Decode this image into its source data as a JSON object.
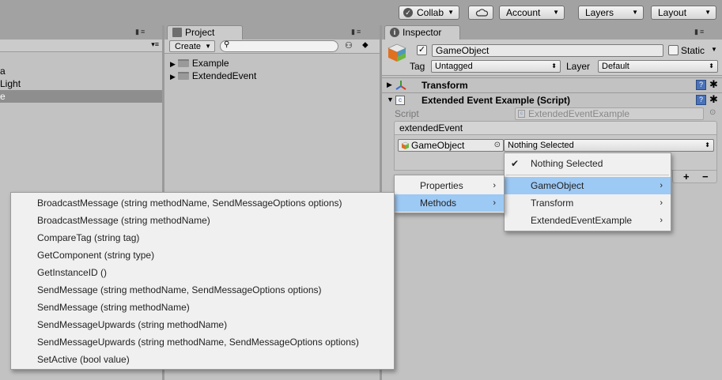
{
  "toolbar": {
    "collab_label": "Collab",
    "account_label": "Account",
    "layers_label": "Layers",
    "layout_label": "Layout"
  },
  "hierarchy": {
    "items": [
      "a",
      "Light",
      "e"
    ]
  },
  "project": {
    "tab_label": "Project",
    "create_label": "Create",
    "search_placeholder": "",
    "items": [
      "Example",
      "ExtendedEvent"
    ]
  },
  "inspector": {
    "tab_label": "Inspector",
    "object_name": "GameObject",
    "static_label": "Static",
    "tag_label": "Tag",
    "tag_value": "Untagged",
    "layer_label": "Layer",
    "layer_value": "Default",
    "transform_label": "Transform",
    "script_component_label": "Extended Event Example (Script)",
    "script_field_label": "Script",
    "script_field_value": "ExtendedEventExample",
    "event_header": "extendedEvent",
    "target_object": "GameObject",
    "function_dropdown": "Nothing Selected",
    "add_symbol": "+",
    "remove_symbol": "−"
  },
  "menus": {
    "function_menu": {
      "items": [
        {
          "label": "Nothing Selected",
          "checked": true,
          "submenu": false
        },
        {
          "label": "GameObject",
          "checked": false,
          "submenu": true,
          "highlight": true
        },
        {
          "label": "Transform",
          "checked": false,
          "submenu": true
        },
        {
          "label": "ExtendedEventExample",
          "checked": false,
          "submenu": true
        }
      ]
    },
    "category_menu": {
      "items": [
        {
          "label": "Properties",
          "highlight": false
        },
        {
          "label": "Methods",
          "highlight": true
        }
      ]
    },
    "methods_menu": {
      "items": [
        "BroadcastMessage (string methodName, SendMessageOptions options)",
        "BroadcastMessage (string methodName)",
        "CompareTag (string tag)",
        "GetComponent (string type)",
        "GetInstanceID ()",
        "SendMessage (string methodName, SendMessageOptions options)",
        "SendMessage (string methodName)",
        "SendMessageUpwards (string methodName)",
        "SendMessageUpwards (string methodName, SendMessageOptions options)",
        "SetActive (bool value)"
      ]
    }
  },
  "colors": {
    "highlight": "#9dc9f5",
    "panel_bg": "#c2c2c2",
    "app_bg": "#a2a2a2"
  }
}
